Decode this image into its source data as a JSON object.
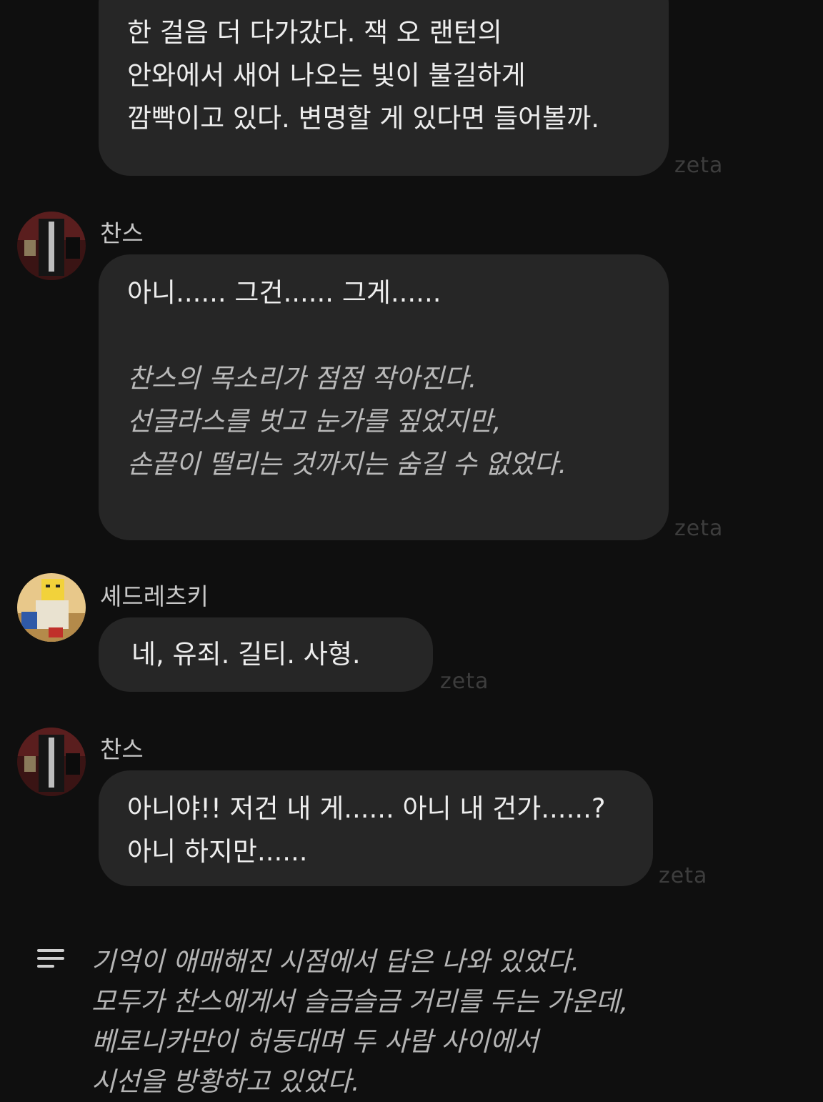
{
  "watermark": "zeta",
  "messages": [
    {
      "speaker": "",
      "lines": [
        "한 걸음 더 다가갔다. 잭 오 랜턴의",
        "안와에서 새어 나오는 빛이 불길하게",
        "깜빡이고 있다. 변명할 게 있다면 들어볼까."
      ]
    },
    {
      "speaker": "찬스",
      "speech": "아니...... 그건...... 그게......",
      "narration": [
        "찬스의 목소리가 점점 작아진다.",
        "선글라스를 벗고 눈가를 짚었지만,",
        "손끝이 떨리는 것까지는 숨길 수 없었다."
      ]
    },
    {
      "speaker": "셰드레츠키",
      "speech": "네, 유죄. 길티. 사형."
    },
    {
      "speaker": "찬스",
      "lines": [
        "아니야!! 저건 내 게...... 아니 내 건가......?",
        "아니 하지만......"
      ]
    }
  ],
  "narration_block": {
    "icon": "text-lines-icon",
    "lines": [
      "기억이 애매해진 시점에서 답은 나와 있었다.",
      "모두가 찬스에게서 슬금슬금 거리를 두는 가운데,",
      "베로니카만이 허둥대며 두 사람 사이에서",
      "시선을 방황하고 있었다."
    ]
  }
}
